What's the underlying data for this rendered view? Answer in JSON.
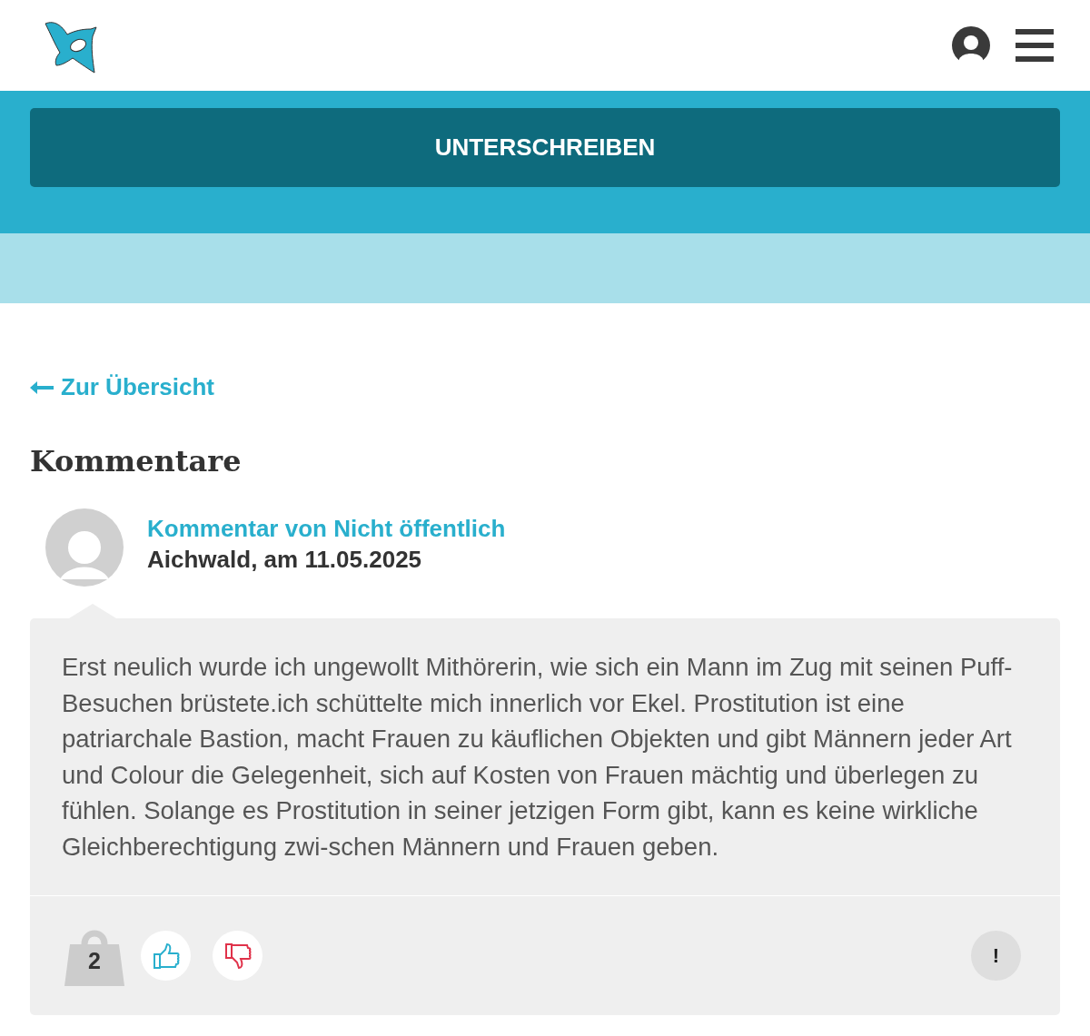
{
  "header": {
    "sign_button": "UNTERSCHREIBEN"
  },
  "back_link": "Zur Übersicht",
  "heading": "Kommentare",
  "comments": [
    {
      "author": "Kommentar von Nicht öffentlich",
      "meta": "Aichwald, am 11.05.2025",
      "text": "Erst neulich wurde ich ungewollt Mithörerin, wie sich ein Mann im Zug mit seinen Puff-Besuchen brüstete.ich schüttelte mich innerlich vor Ekel. Prostitution ist eine patriarchale Bastion, macht Frauen zu käuflichen Objekten und gibt Männern jeder Art und Colour die Gelegenheit, sich auf Kosten von Frauen mächtig und überlegen zu fühlen. Solange es Prostitution in seiner jetzigen Form gibt, kann es keine wirkliche Gleichberechtigung zwi-schen Männern und Frauen geben.",
      "weight": "2",
      "report": "!"
    }
  ]
}
